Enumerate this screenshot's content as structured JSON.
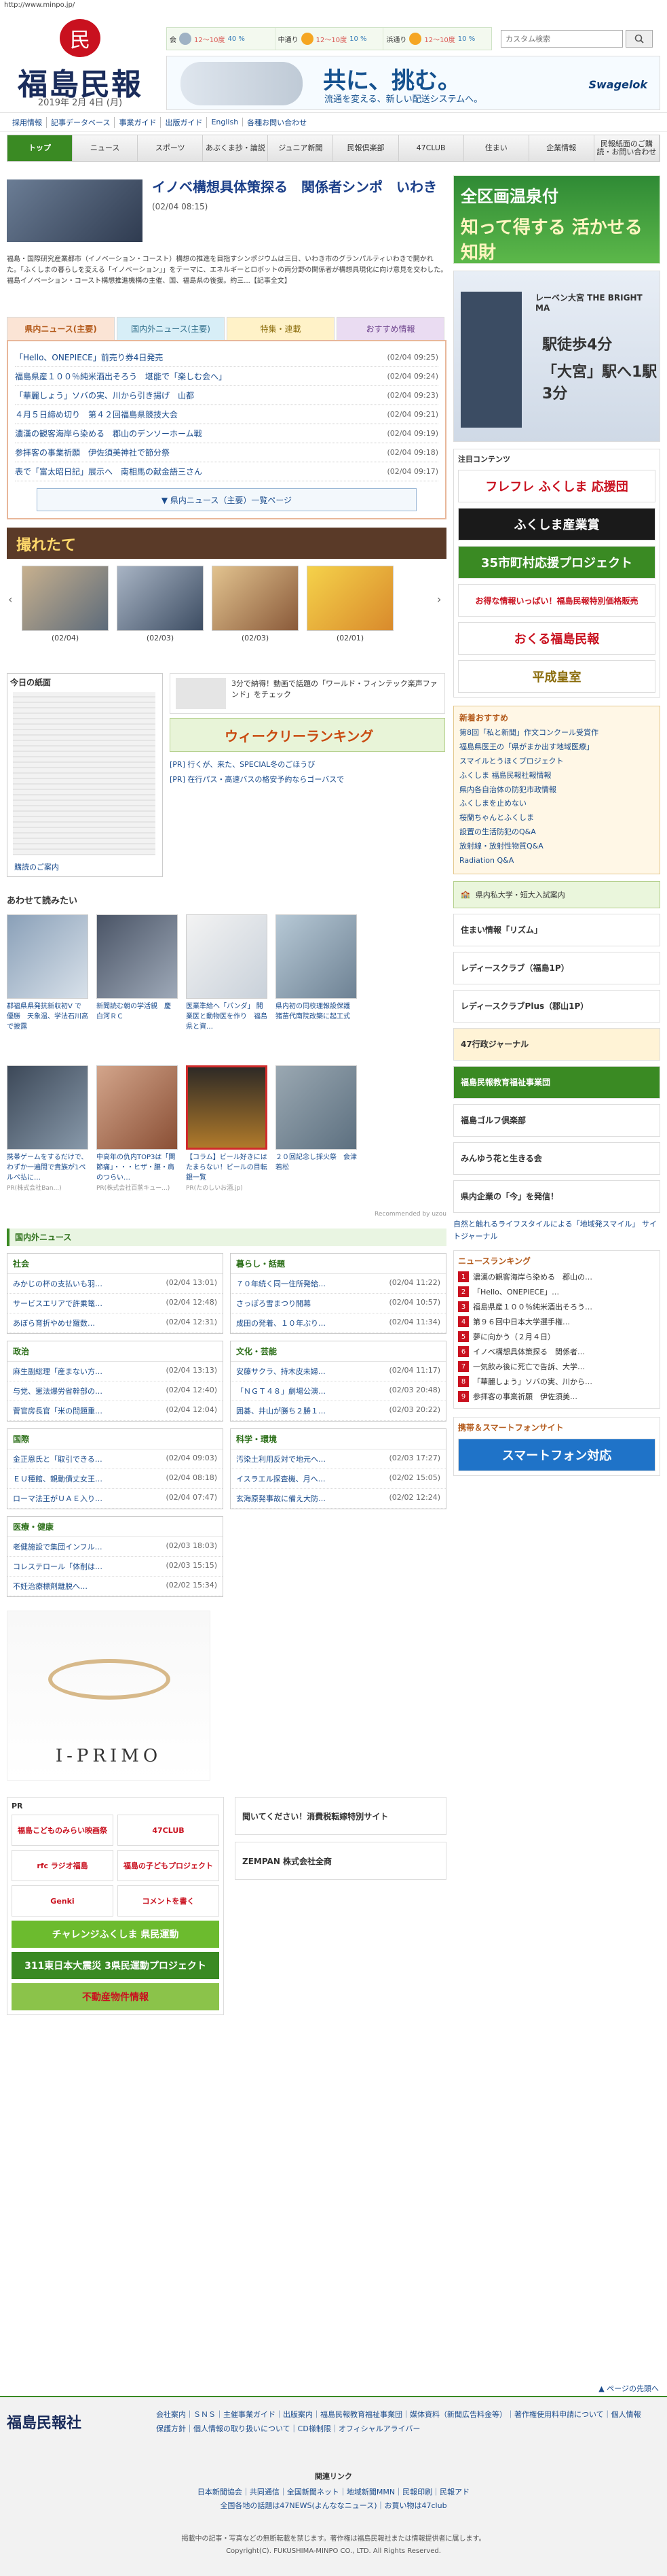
{
  "url": "http://www.minpo.jp/",
  "header": {
    "logo_text": "福島民報",
    "logo_mark": "民",
    "date": "2019年 2月 4日 (月)",
    "search_placeholder": "カスタム検索",
    "weather": [
      {
        "area": "会",
        "temp": "12〜10度",
        "rain": "40 %",
        "icon": "cloud-icon"
      },
      {
        "area": "中通り",
        "temp": "12〜10度",
        "rain": "10 %",
        "icon": "sun-icon"
      },
      {
        "area": "浜通り",
        "temp": "12〜10度",
        "rain": "10 %",
        "icon": "sun-icon"
      }
    ],
    "ad_copy": "共に、挑む。",
    "ad_sub": "流通を変える、新しい配送システムへ。",
    "ad_brand": "Swagelok"
  },
  "subnav": [
    "採用情報",
    "記事データベース",
    "事業ガイド",
    "出版ガイド",
    "English",
    "各種お問い合わせ"
  ],
  "gnav": [
    "トップ",
    "ニュース",
    "スポーツ",
    "あぶくま抄・論説",
    "ジュニア新聞",
    "民報倶楽部",
    "47CLUB",
    "住まい",
    "企業情報",
    "民報紙面のご購読・お問い合わせ"
  ],
  "top_story": {
    "title": "イノベ構想具体策探る　関係者シンポ　いわき",
    "date": "(02/04 08:15)",
    "lead": "福島・国際研究産業都市（イノベーション・コースト）構想の推進を目指すシンポジウムは三日、いわき市のグランパルティいわきで開かれた。「ふくしまの暮らしを変える「イノベーション」」をテーマに、エネルギーとロボットの両分野の関係者が構想具現化に向け意見を交わした。　福島イノベーション・コースト構想推進機構の主催、国、福島県の後援。約三...【記事全文】"
  },
  "tabs": [
    "県内ニュース(主要)",
    "国内外ニュース(主要)",
    "特集・連載",
    "おすすめ情報"
  ],
  "news": [
    {
      "t": "「Hello、ONEPIECE」前売り券4日発売",
      "d": "(02/04 09:25)"
    },
    {
      "t": "福島県産１００％純米酒出そろう　堪能で「楽しむ会へ」",
      "d": "(02/04 09:24)"
    },
    {
      "t": "「華麗しょう」ソバの実、川から引き揚げ　山都",
      "d": "(02/04 09:23)"
    },
    {
      "t": "４月５日締め切り　第４２回福島県競技大会",
      "d": "(02/04 09:21)"
    },
    {
      "t": "濃漢の観客海岸ら染める　郡山のデンソーホーム戦",
      "d": "(02/04 09:19)"
    },
    {
      "t": "参拝客の事業祈願　伊佐須美神社で節分祭",
      "d": "(02/04 09:18)"
    },
    {
      "t": "表で「富太昭日記」展示へ　南相馬の献金語三さん",
      "d": "(02/04 09:17)"
    }
  ],
  "news_more": "▼ 県内ニュース（主要）一覧ページ",
  "photo_title": "撮れたて",
  "photos": [
    "(02/04)",
    "(02/03)",
    "(02/03)",
    "(02/01)"
  ],
  "paper": {
    "title": "今日の紙面",
    "link": "購読のご案内",
    "ad_text": "3分で納得！動画で話題の「ワールド・フィンテック楽声ファンド」をチェック",
    "rank": "ウィークリーランキング",
    "pr": [
      "[PR] 行くが、来た、SPECIAL冬のごほうび",
      "[PR] 在行パス・高速バスの格安予約ならゴーバスで"
    ]
  },
  "rec_head": "あわせて読みたい",
  "rec": [
    {
      "t": "郡福県県発抗新収初V で優勝　天象温、学法石川高で披露",
      "s": ""
    },
    {
      "t": "新聞読む朝の学活親　慶　白河ＲＣ",
      "s": ""
    },
    {
      "t": "医業準給へ「パンダ」 開業医と動物医を作り　福島県と資…",
      "s": ""
    },
    {
      "t": "県内初の同校理報設保護　猪苗代南院改築に起工式",
      "s": ""
    },
    {
      "t": "",
      "s": ""
    },
    {
      "t": "携帯ゲームをするだけで、わずか一遍間で貴族が1ペルペ払に…",
      "s": "PR(株式会社Ban...)"
    },
    {
      "t": "中高年の仇内TOP3は「関節痛」・・・ヒザ・腰・肩のつらい…",
      "s": "PR(株式会社百蒸キュー...)"
    },
    {
      "t": "【コラム】ビール好きにはたまらない！ビールの目転銀一覧",
      "s": "PR(たのしいお酒.jp)"
    },
    {
      "t": "２０回記念し採火祭　会津若松",
      "s": ""
    },
    {
      "t": "",
      "s": ""
    }
  ],
  "rec_by": "Recommended by uzou",
  "domestic_head": "国内外ニュース",
  "categories": [
    {
      "name": "社会",
      "rows": [
        {
          "t": "みかじの杯の支払いも羽…",
          "d": "(02/04 13:01)"
        },
        {
          "t": "サービスエリアで許乗篭…",
          "d": "(02/04 12:48)"
        },
        {
          "t": "あぼら育折やめせ羅数…",
          "d": "(02/04 12:31)"
        }
      ]
    },
    {
      "name": "暮らし・話題",
      "rows": [
        {
          "t": "７０年続く同一住所発給…",
          "d": "(02/04 11:22)"
        },
        {
          "t": "さっぽろ雪まつり開幕",
          "d": "(02/04 10:57)"
        },
        {
          "t": "成田の発着、１０年ぶり…",
          "d": "(02/04 11:34)"
        }
      ]
    },
    {
      "name": "政治",
      "rows": [
        {
          "t": "麻生副総理「産まない方…",
          "d": "(02/04 13:13)"
        },
        {
          "t": "与党、憲法爆労省幹部の…",
          "d": "(02/04 12:40)"
        },
        {
          "t": "菅官房長官「米の問題重…",
          "d": "(02/04 12:04)"
        }
      ]
    },
    {
      "name": "文化・芸能",
      "rows": [
        {
          "t": "安藤サクラ、持木皮未婦…",
          "d": "(02/04 11:17)"
        },
        {
          "t": "「ＮＧＴ４８」劇場公演…",
          "d": "(02/03 20:48)"
        },
        {
          "t": "囲碁、井山が勝ち２勝１…",
          "d": "(02/03 20:22)"
        }
      ]
    },
    {
      "name": "国際",
      "rows": [
        {
          "t": "金正恩氏と「取引できる…",
          "d": "(02/04 09:03)"
        },
        {
          "t": "ＥＵ種館、親動債丈女王…",
          "d": "(02/04 08:18)"
        },
        {
          "t": "ローマ法王がＵＡＥ入り…",
          "d": "(02/04 07:47)"
        }
      ]
    },
    {
      "name": "科学・環境",
      "rows": [
        {
          "t": "汚染土利用反対で地元へ…",
          "d": "(02/03 17:27)"
        },
        {
          "t": "イスラエル探査機、月へ…",
          "d": "(02/02 15:05)"
        },
        {
          "t": "玄海原発事故に備え大防…",
          "d": "(02/02 12:24)"
        }
      ]
    },
    {
      "name": "医療・健康",
      "rows": [
        {
          "t": "老健施設で集団インフル…",
          "d": "(02/03 18:03)"
        },
        {
          "t": "コレステロール「体削は…",
          "d": "(02/03 15:15)"
        },
        {
          "t": "不妊治療標剤離脱へ…",
          "d": "(02/02 15:34)"
        }
      ]
    }
  ],
  "bottom_ad_brand": "I-PRIMO",
  "pr": {
    "label": "PR",
    "items": [
      "福島こどものみらい映画祭",
      "47CLUB",
      "rfc ラジオ福島",
      "福島の子どもプロジェクト",
      "Genki",
      "コメントを書く"
    ],
    "wide1": "チャレンジふくしま 県民運動",
    "wide2": "311東日本大震災 3県民運動プロジェクト",
    "wide3": "不動産物件情報",
    "side": [
      "聞いてください！消費税転嫁特別サイト",
      "ZEMPAN 株式会社全商"
    ]
  },
  "right": {
    "ad1_a": "全区画温泉付",
    "ad1_b": "知って得する 活かせる知財",
    "ad2_a": "レーベン大宮 THE BRIGHT MA",
    "ad2_b": "駅徒歩4分",
    "ad2_c": "「大宮」駅へ1駅3分",
    "contents_head": "注目コンテンツ",
    "banners": [
      "フレフレ ふくしま 応援団",
      "ふくしま産業賞",
      "35市町村応援プロジェクト",
      "お得な情報いっぱい！福島民報特別価格販売",
      "おくる福島民報",
      "平成皇室"
    ],
    "osusume_head": "新着おすすめ",
    "osusume": [
      "第8回「私と新聞」作文コンクール受賞作",
      "福島県医王の「県がまか出す地域医療」",
      "スマイルとうほくプロジェクト",
      "ふくしま 福島民報社報情報",
      "県内各自治体の防犯市政情報",
      "ふくしまを止めない",
      "桜蘭ちゃんとふくしま",
      "設置の生活防犯のQ&A",
      "放射線・放射性物質Q&A",
      "Radiation Q&A"
    ],
    "fk": "県内私大学・短大入試案内",
    "r_banners": [
      "住まい情報「リズム」",
      "レディースクラブ（福島1P）",
      "レディースクラブPlus（郡山1P）",
      "47行政ジャーナル",
      "福島民報教育福祉事業団",
      "福島ゴルフ倶楽部",
      "みんゆう花と生きる会",
      "県内企業の「今」を発信！"
    ],
    "column": "自然と触れるライフスタイルによる「地域発スマイル」 サイトジャーナル",
    "rank_head": "ニュースランキング",
    "ranking": [
      "濃漢の観客海岸ら染める　郡山の…",
      "「Hello、ONEPIECE」…",
      "福島県産１００％純米酒出そろう…",
      "第９６回中日本大学選手権…",
      "夢に向かう（２月４日）",
      "イノベ構想具体策探る　関係者…",
      "一気飲み後に死亡で告訴、大学…",
      "「華麗しょう」ソバの実、川から…",
      "参拝客の事業祈願　伊佐須美…"
    ],
    "mobile_head": "携帯＆スマートフォンサイト",
    "mobile_banner": "スマートフォン対応"
  },
  "footer": {
    "pagetop": "▲ ページの先頭へ",
    "logo": "福島民報社",
    "links": "会社案内｜ＳＮＳ｜主催事業ガイド｜出版案内｜福島民報教育福祉事業団｜媒体資料（新聞広告料金等）｜著作権使用料申請について｜個人情報保護方針｜個人情報の取り扱いについて｜CD様制限｜オフィシャルアライバー",
    "rel_head": "関連リンク",
    "rel": "日本新聞協会｜共同通信｜全国新聞ネット｜地域新聞MMN｜民報印刷｜民報アド\n全国各地の話題は47NEWS(よんななニュース)｜お買い物は47club",
    "copy": "掲載中の記事・写真などの無断転載を禁じます。著作権は福島民報社または情報提供者に属します。\nCopyright(C). FUKUSHIMA-MINPO CO., LTD. All Rights Reserved."
  }
}
